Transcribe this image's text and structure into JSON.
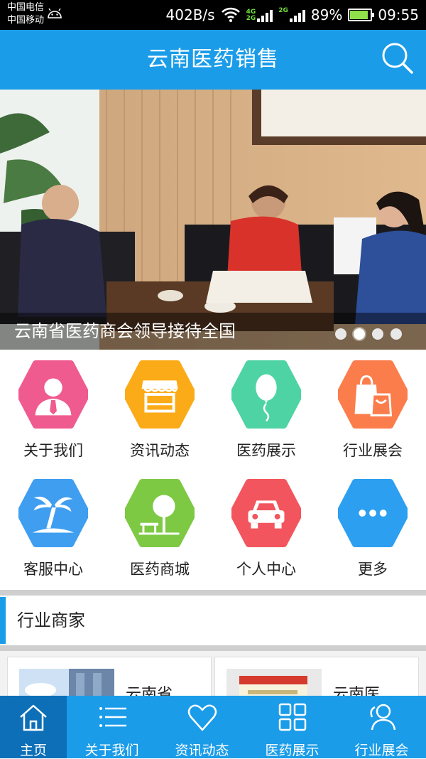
{
  "status_bar": {
    "carrier_1": "中国电信",
    "carrier_2": "中国移动",
    "speed": "402B/s",
    "tag_4g": "4G",
    "tag_2g_a": "2G",
    "tag_2g_b": "2G",
    "battery": "89%",
    "battery_level": 0.89,
    "time": "09:55"
  },
  "header": {
    "title": "云南医药销售",
    "icon": "search-icon",
    "color": "#1a9ce8"
  },
  "banner": {
    "caption": "云南省医药商会领导接待全国",
    "slide_count": 4,
    "active_slide": 2
  },
  "grid": {
    "items": [
      {
        "label": "关于我们",
        "icon": "person-icon",
        "color": "#ef5b8f"
      },
      {
        "label": "资讯动态",
        "icon": "store-icon",
        "color": "#fbab18"
      },
      {
        "label": "医药展示",
        "icon": "balloon-icon",
        "color": "#4ed3a4"
      },
      {
        "label": "行业展会",
        "icon": "shopping-bag-icon",
        "color": "#fb7d4c"
      },
      {
        "label": "客服中心",
        "icon": "palm-tree-icon",
        "color": "#3f9ef0"
      },
      {
        "label": "医药商城",
        "icon": "tree-bench-icon",
        "color": "#7ec944"
      },
      {
        "label": "个人中心",
        "icon": "car-icon",
        "color": "#f2555d"
      },
      {
        "label": "更多",
        "icon": "more-icon",
        "color": "#2d9ff0"
      }
    ]
  },
  "section": {
    "title": "行业商家"
  },
  "merchants": [
    {
      "name": "云南省..."
    },
    {
      "name": "云南医..."
    }
  ],
  "bottom_nav": [
    {
      "label": "主页",
      "icon": "home-icon",
      "active": true
    },
    {
      "label": "关于我们",
      "icon": "list-icon",
      "active": false
    },
    {
      "label": "资讯动态",
      "icon": "heart-icon",
      "active": false
    },
    {
      "label": "医药展示",
      "icon": "grid-icon",
      "active": false
    },
    {
      "label": "行业展会",
      "icon": "users-icon",
      "active": false
    }
  ]
}
